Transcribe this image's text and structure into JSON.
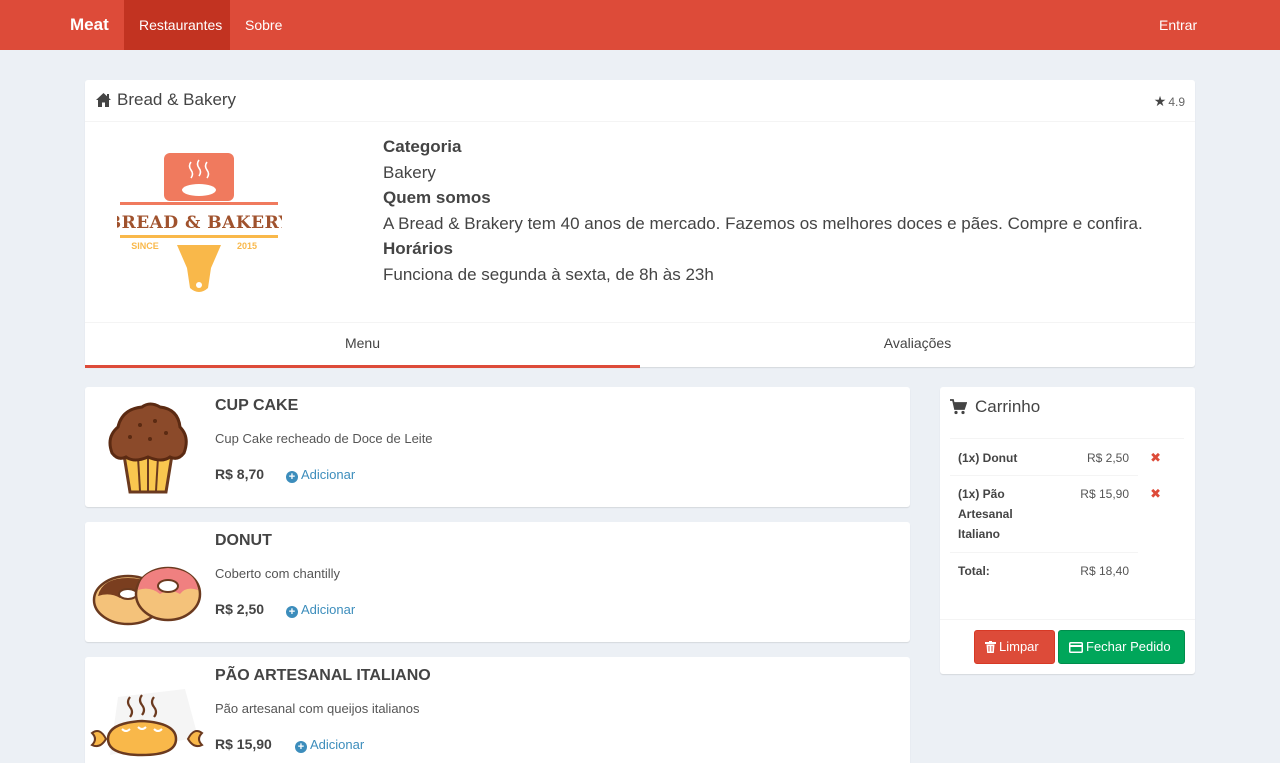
{
  "navbar": {
    "brand": "Meat",
    "items": [
      {
        "label": "Restaurantes",
        "active": true
      },
      {
        "label": "Sobre",
        "active": false
      }
    ],
    "login_label": "Entrar",
    "color": "#dd4b39"
  },
  "restaurant": {
    "name": "Bread & Bakery",
    "rating": "4.9",
    "logo": {
      "line1": "BREAD & BAKERY",
      "since": "SINCE",
      "year": "2015"
    },
    "info": {
      "categoria_label": "Categoria",
      "categoria": "Bakery",
      "quem_somos_label": "Quem somos",
      "quem_somos": "A Bread & Brakery tem 40 anos de mercado. Fazemos os melhores doces e pães. Compre e confira.",
      "horarios_label": "Horários",
      "horarios": "Funciona de segunda à sexta, de 8h às 23h"
    },
    "tabs": [
      {
        "label": "Menu",
        "active": true
      },
      {
        "label": "Avaliações",
        "active": false
      }
    ]
  },
  "menu": [
    {
      "name": "CUP CAKE",
      "description": "Cup Cake recheado de Doce de Leite",
      "price": "R$ 8,70",
      "add_label": "Adicionar",
      "icon": "cupcake-image"
    },
    {
      "name": "DONUT",
      "description": "Coberto com chantilly",
      "price": "R$ 2,50",
      "add_label": "Adicionar",
      "icon": "donut-image"
    },
    {
      "name": "PÃO ARTESANAL ITALIANO",
      "description": "Pão artesanal com queijos italianos",
      "price": "R$ 15,90",
      "add_label": "Adicionar",
      "icon": "bread-image"
    }
  ],
  "cart": {
    "title": "Carrinho",
    "items": [
      {
        "name": "(1x) Donut",
        "price": "R$ 2,50"
      },
      {
        "name": "(1x) Pão Artesanal Italiano",
        "price": "R$ 15,90"
      }
    ],
    "total_label": "Total:",
    "total": "R$ 18,40",
    "clear_label": "Limpar",
    "checkout_label": "Fechar Pedido"
  }
}
